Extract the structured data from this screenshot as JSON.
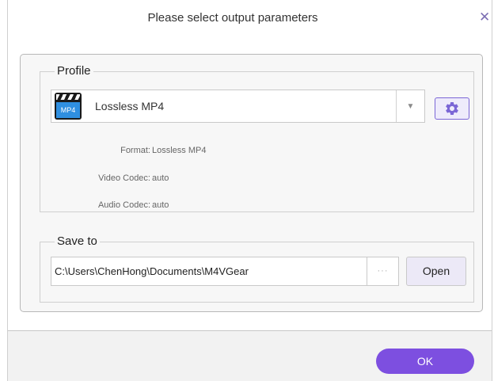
{
  "dialog": {
    "title": "Please select output parameters",
    "close_icon": "close-icon",
    "close_glyph": "✕"
  },
  "profile": {
    "legend": "Profile",
    "icon": "mp4-icon",
    "icon_text": "MP4",
    "selected": "Lossless MP4",
    "dropdown_icon": "chevron-down-icon",
    "dropdown_glyph": "▼",
    "settings_icon": "gear-icon",
    "format_label": "Format:",
    "format_value": "Lossless MP4",
    "video_codec_label": "Video Codec:",
    "video_codec_value": "auto",
    "audio_codec_label": "Audio Codec:",
    "audio_codec_value": "auto"
  },
  "save_to": {
    "legend": "Save to",
    "path": "C:\\Users\\ChenHong\\Documents\\M4VGear",
    "browse_label": "···",
    "open_label": "Open"
  },
  "footer": {
    "ok_label": "OK"
  },
  "colors": {
    "accent": "#7d4fe0",
    "accent_light": "#eeebfb",
    "close": "#7d6fb3",
    "panel_bg": "#f7f7f7",
    "footer_bg": "#f2f2f2"
  }
}
